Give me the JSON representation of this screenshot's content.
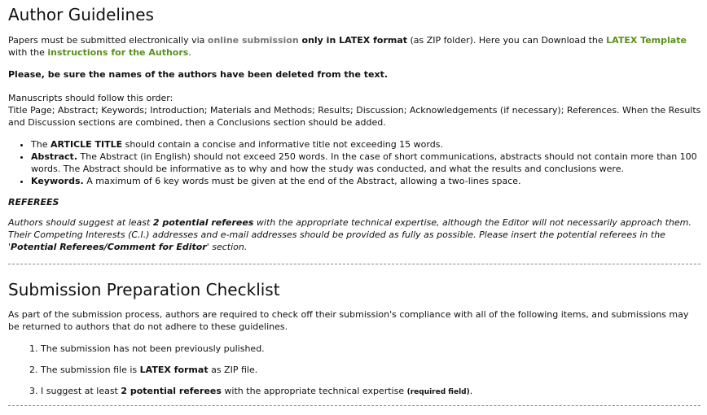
{
  "guidelines": {
    "heading": "Author Guidelines",
    "intro": {
      "t1": "Papers must be submitted electronically via ",
      "link_online": "online submission",
      "t2": " only in  LATEX format",
      "t3": " (as ZIP folder). Here you can Download the ",
      "link_template": "LATEX Template",
      "t4": " with the ",
      "link_instructions": "instructions for the Authors",
      "t5": "."
    },
    "warning": "Please, be sure the names of the authors have been deleted from the text.",
    "order_intro": "Manuscripts should follow this order:",
    "order_text": "Title Page; Abstract; Keywords; Introduction; Materials and Methods; Results; Discussion; Acknowledgements (if necessary); References. When the Results and Discussion sections are combined, then a Conclusions section should be added.",
    "items": [
      {
        "pre": "The ",
        "bold": "ARTICLE TITLE",
        "post": " should contain a concise and informative title not exceeding 15 words."
      },
      {
        "pre": "",
        "bold": "Abstract.",
        "post": " The Abstract (in English) should not exceed 250 words. In the case of short communications, abstracts should not contain more than 100 words. The Abstract should be informative as to why and how the study was conducted, and what the results and conclusions were."
      },
      {
        "pre": "",
        "bold": "Keywords.",
        "post": " A maximum of 6 key words must be given at the end of the Abstract, allowing a two-lines space."
      }
    ],
    "referees_heading": "REFEREES",
    "referees": {
      "t1": "Authors should suggest at least ",
      "b1": "2 potential referees",
      "t2": " with the appropriate technical expertise, although the Editor will not necessarily approach them. Their Competing Interests (C.I.) addresses and e-mail addresses should be provided as fully as possible. Please insert the potential referees in the '",
      "b2": "Potential Referees/Comment for Editor",
      "t3": "' section."
    }
  },
  "checklist": {
    "heading": "Submission Preparation Checklist",
    "intro": "As part of the submission process, authors are required to check off their submission's compliance with all of the following items, and submissions may be returned to authors that do not adhere to these guidelines.",
    "items": [
      {
        "pre": "The submission has not been previously pulished.",
        "bold": "",
        "post": "",
        "small": "",
        "end": ""
      },
      {
        "pre": "The submission file is ",
        "bold": "LATEX format",
        "post": " as ZIP file.",
        "small": "",
        "end": ""
      },
      {
        "pre": "I suggest at least ",
        "bold": "2 potential referees",
        "post": " with the appropriate technical expertise ",
        "small": "(required field)",
        "end": "."
      }
    ]
  },
  "colors": {
    "link_green": "#5a8f1d",
    "link_grey": "#777777"
  }
}
